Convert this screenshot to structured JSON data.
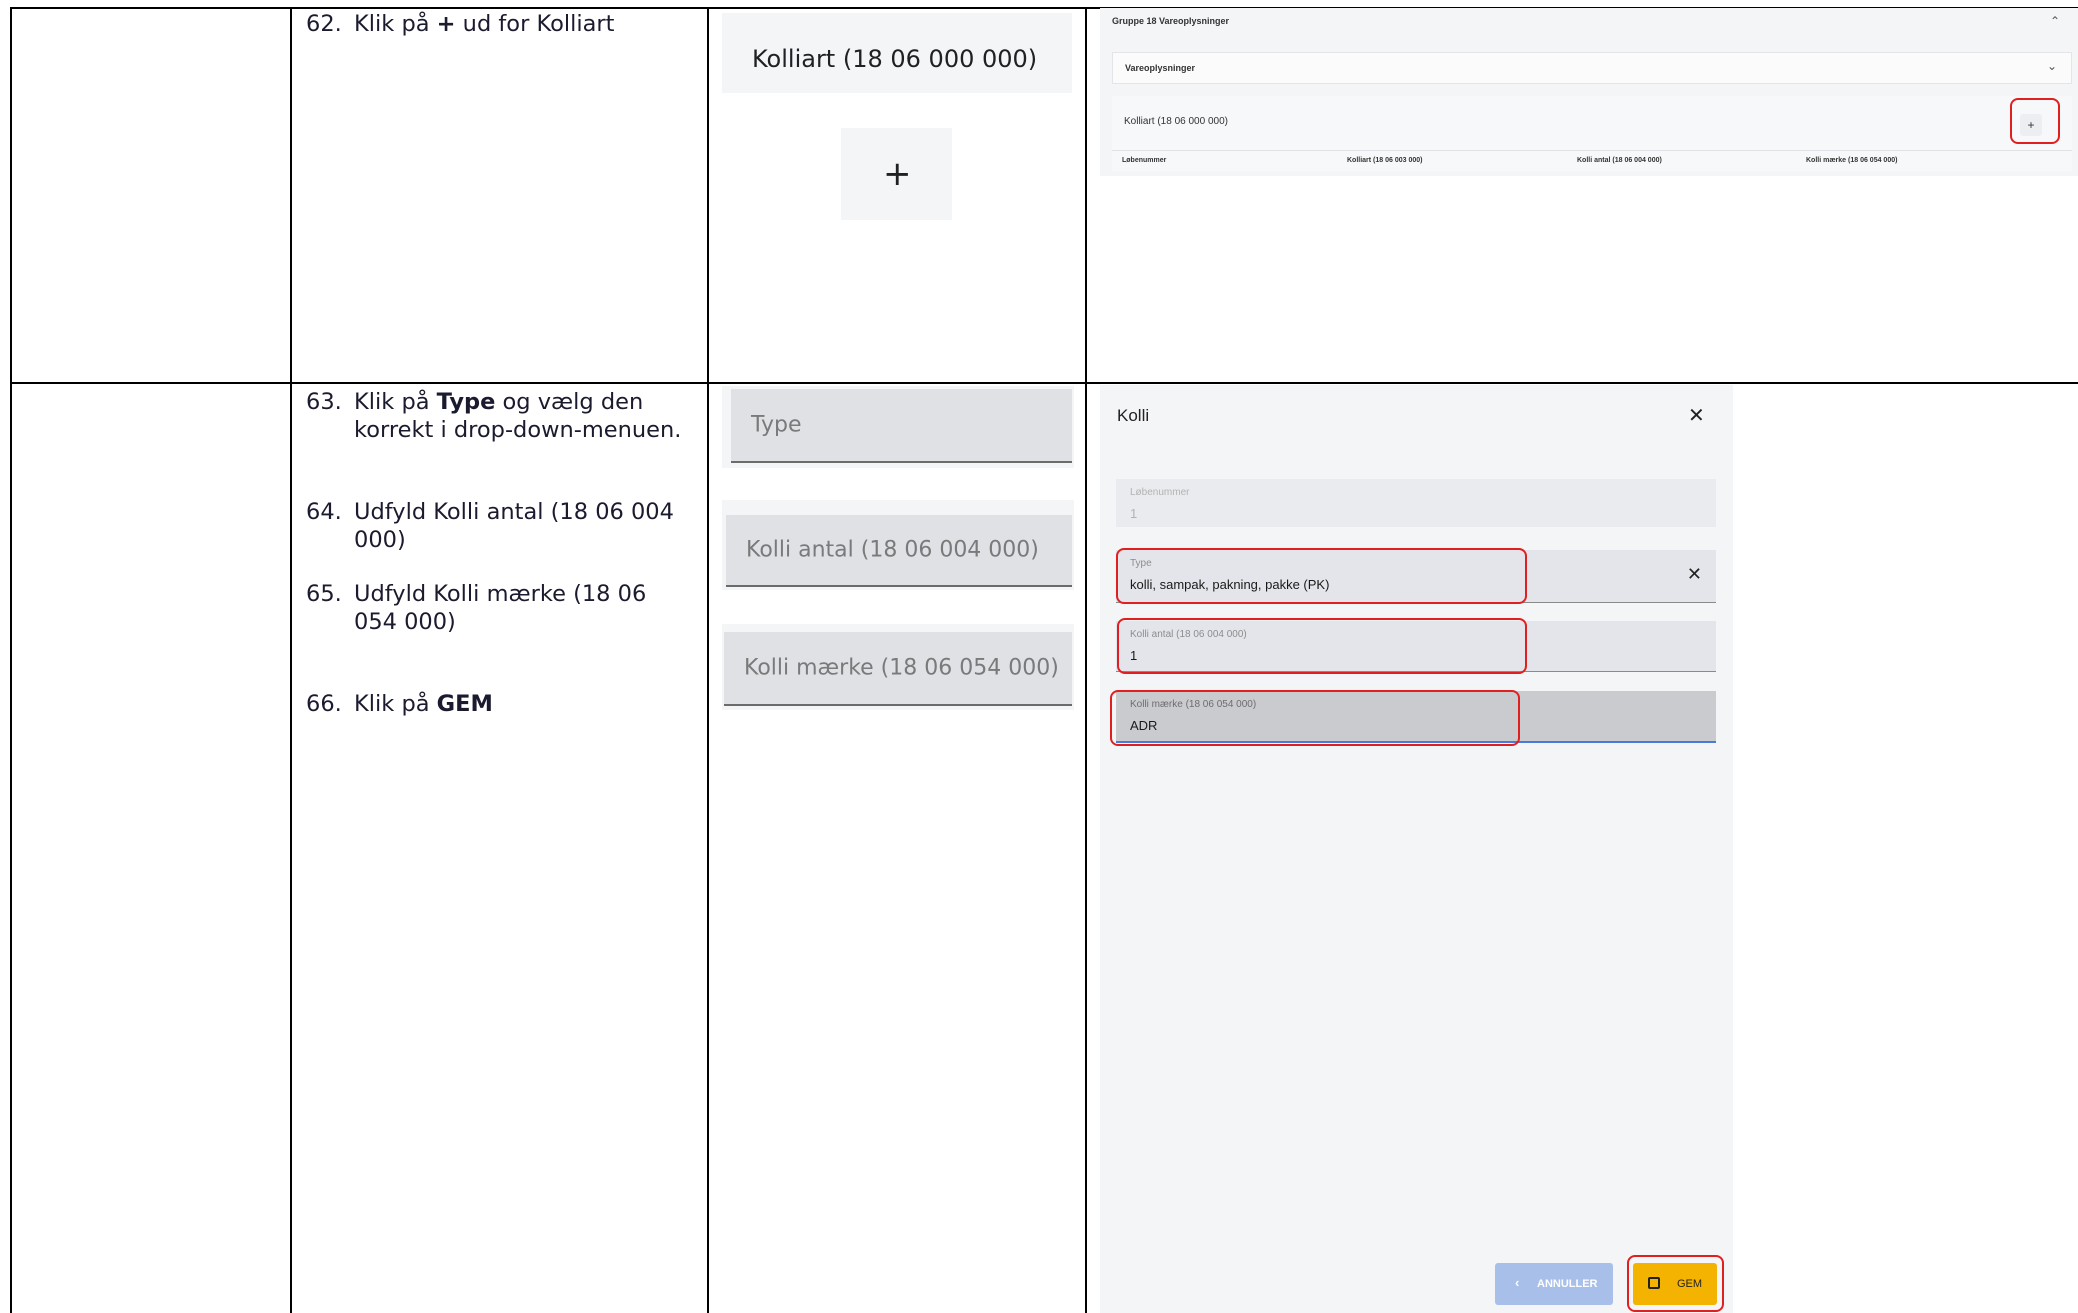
{
  "steps": [
    {
      "num": "62.",
      "pre": "Klik på ",
      "bold": "+",
      "post": " ud for Kolliart"
    },
    {
      "num": "63.",
      "pre": "Klik på ",
      "bold": "Type",
      "post": " og vælg den korrekt i drop-down-menuen."
    },
    {
      "num": "64.",
      "text": "Udfyld Kolli antal (18 06 004 000)"
    },
    {
      "num": "65.",
      "text": "Udfyld Kolli mærke (18 06 054 000)"
    },
    {
      "num": "66.",
      "pre": "Klik på ",
      "bold": "GEM",
      "post": ""
    }
  ],
  "zoom": {
    "kolliart_label": "Kolliart (18 06 000 000)",
    "plus_symbol": "+",
    "type_placeholder": "Type",
    "kolli_antal_placeholder": "Kolli antal (18 06 004 000)",
    "kolli_maerke_placeholder": "Kolli mærke (18 06 054 000)"
  },
  "screen1": {
    "group_title": "Gruppe 18 Vareoplysninger",
    "section_title": "Vareoplysninger",
    "row_label": "Kolliart (18 06 000 000)",
    "add_symbol": "+",
    "columns": [
      "Løbenummer",
      "Kolliart (18 06 003 000)",
      "Kolli antal (18 06 004 000)",
      "Kolli mærke (18 06 054 000)"
    ]
  },
  "dialog": {
    "title": "Kolli",
    "fields": [
      {
        "label": "Løbenummer",
        "value": "1"
      },
      {
        "label": "Type",
        "value": "kolli, sampak, pakning, pakke (PK)"
      },
      {
        "label": "Kolli antal (18 06 004 000)",
        "value": "1"
      },
      {
        "label": "Kolli mærke (18 06 054 000)",
        "value": "ADR"
      }
    ],
    "cancel_label": "ANNULLER",
    "save_label": "GEM"
  },
  "colors": {
    "highlight": "#e02020",
    "save_button": "#f5b301",
    "cancel_button": "#a8bfe9"
  }
}
